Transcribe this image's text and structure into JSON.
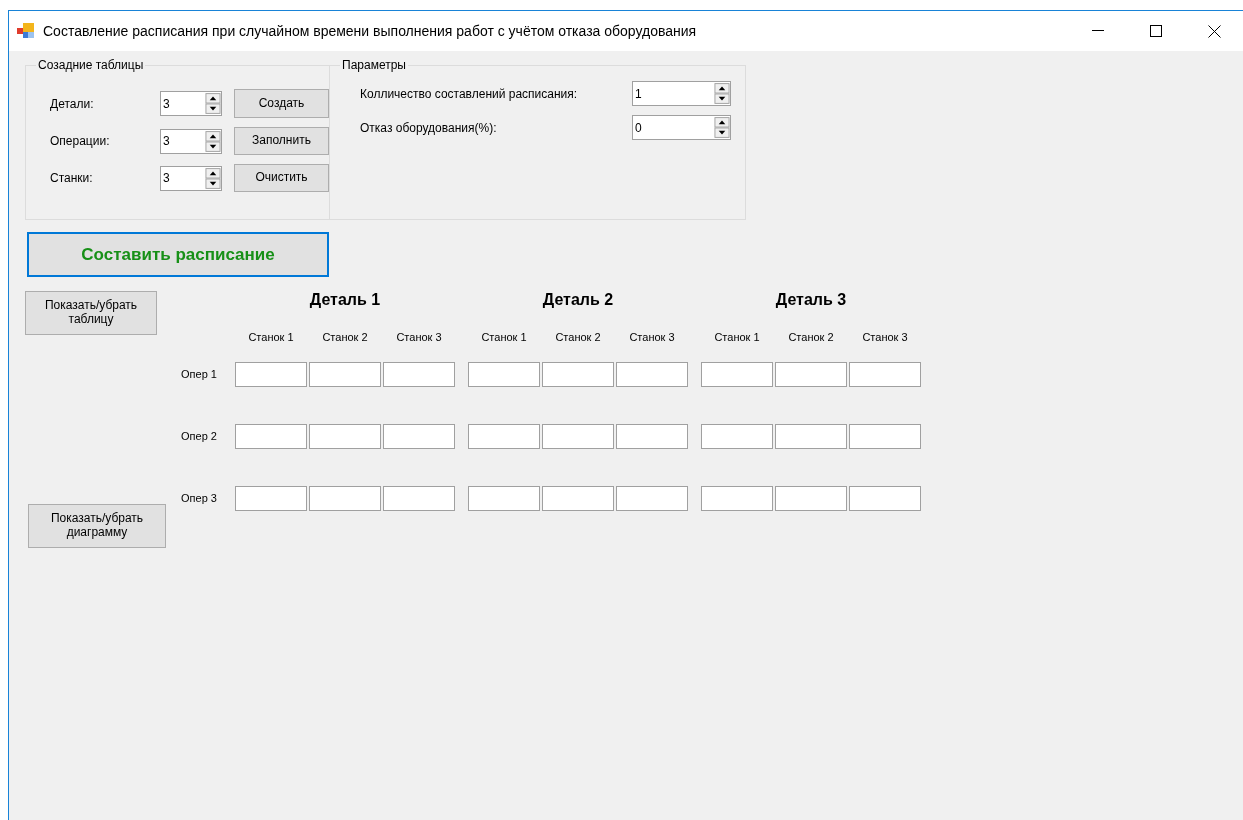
{
  "window": {
    "title": "Составление расписания при случайном времени выполнения работ с учётом отказа оборудования"
  },
  "table_setup": {
    "title": "Созадние таблицы",
    "fields": [
      {
        "label": "Детали:",
        "value": "3"
      },
      {
        "label": "Операции:",
        "value": "3"
      },
      {
        "label": "Станки:",
        "value": "3"
      }
    ],
    "buttons": [
      "Создать",
      "Заполнить",
      "Очистить"
    ]
  },
  "parameters": {
    "title": "Параметры",
    "fields": [
      {
        "label": "Колличество составлений расписания:",
        "value": "1"
      },
      {
        "label": "Отказ оборудования(%):",
        "value": "0"
      }
    ]
  },
  "schedule_button": "Составить расписание",
  "toggle_table_button": "Показать/убрать таблицу",
  "details": [
    {
      "title": "Деталь 1",
      "columns": [
        "Станок 1",
        "Станок 2",
        "Станок 3"
      ]
    },
    {
      "title": "Деталь 2",
      "columns": [
        "Станок 1",
        "Станок 2",
        "Станок 3"
      ]
    },
    {
      "title": "Деталь 3",
      "columns": [
        "Станок 1",
        "Станок 2",
        "Станок 3"
      ]
    }
  ],
  "operations": [
    "Опер 1",
    "Опер 2",
    "Опер 3"
  ],
  "toggle_chart_button": "Показать/убрать диаграмму"
}
